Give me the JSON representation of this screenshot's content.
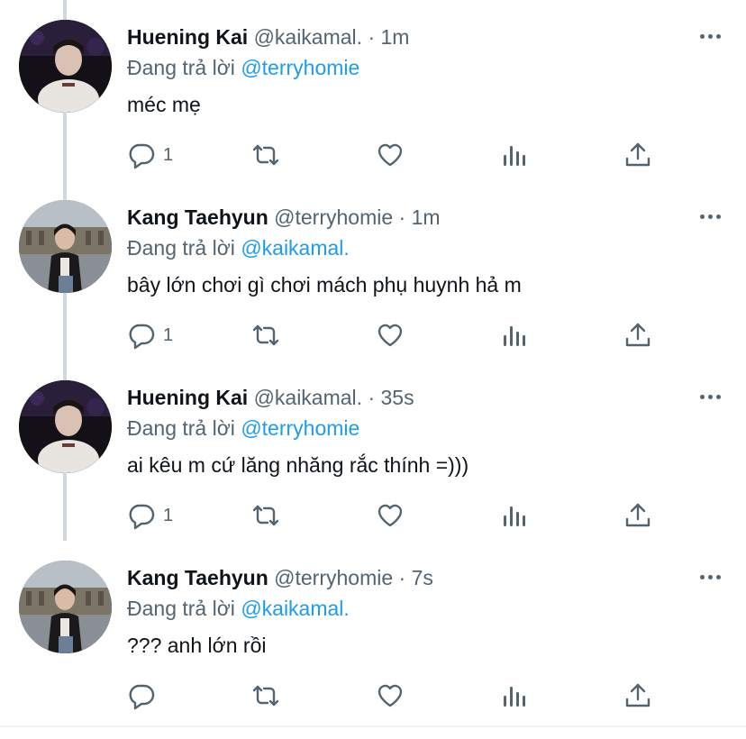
{
  "reply_prefix": "Đang trả lời",
  "tweets": [
    {
      "name": "Huening Kai",
      "handle": "@kaikamal.",
      "separator": "·",
      "time": "1m",
      "reply_to": "@terryhomie",
      "text": "méc mẹ",
      "reply_count": "1",
      "avatar": "avatar-huening-kai"
    },
    {
      "name": "Kang Taehyun",
      "handle": "@terryhomie",
      "separator": "·",
      "time": "1m",
      "reply_to": "@kaikamal.",
      "text": "bây lớn chơi gì chơi mách phụ huynh hả m",
      "reply_count": "1",
      "avatar": "avatar-kang-taehyun"
    },
    {
      "name": "Huening Kai",
      "handle": "@kaikamal.",
      "separator": "·",
      "time": "35s",
      "reply_to": "@terryhomie",
      "text": "ai kêu m cứ lăng nhăng rắc thính =)))",
      "reply_count": "1",
      "avatar": "avatar-huening-kai"
    },
    {
      "name": "Kang Taehyun",
      "handle": "@terryhomie",
      "separator": "·",
      "time": "7s",
      "reply_to": "@kaikamal.",
      "text": "??? anh lớn rồi",
      "reply_count": "",
      "avatar": "avatar-kang-taehyun"
    }
  ],
  "colors": {
    "text": "#0f1419",
    "secondary": "#536471",
    "link": "#1d9bf0",
    "thread_line": "#cfd9de"
  },
  "icons": [
    "reply-icon",
    "retweet-icon",
    "like-icon",
    "views-icon",
    "share-icon",
    "more-icon"
  ]
}
